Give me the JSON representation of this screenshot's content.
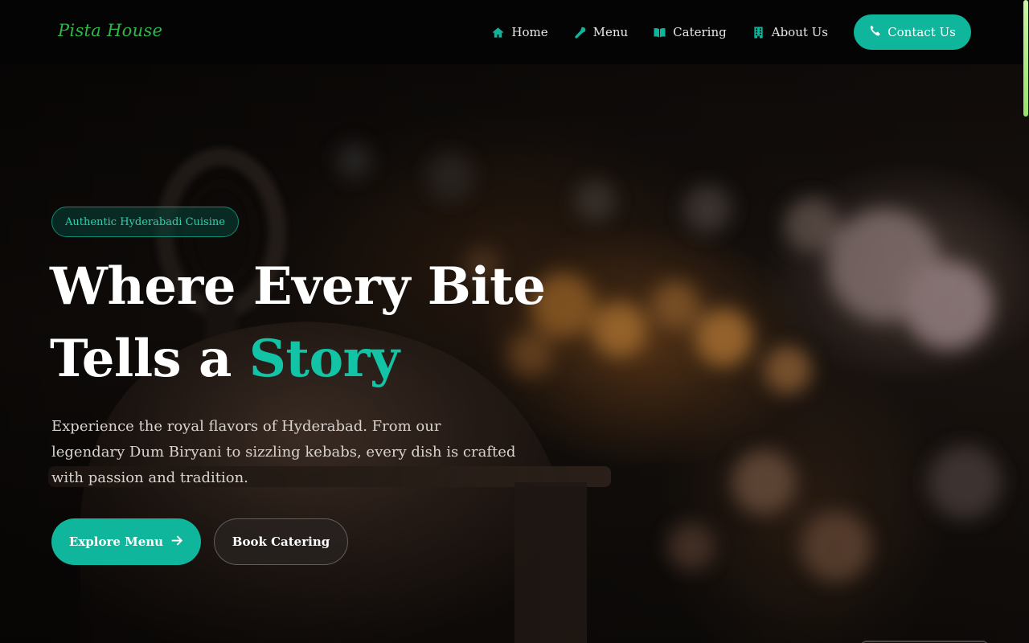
{
  "header": {
    "logo": "Pista House",
    "nav": [
      {
        "label": "Home",
        "icon": "home-icon"
      },
      {
        "label": "Menu",
        "icon": "utensil-icon"
      },
      {
        "label": "Catering",
        "icon": "book-open-icon"
      },
      {
        "label": "About Us",
        "icon": "building-icon"
      }
    ],
    "contact": {
      "label": "Contact Us",
      "icon": "phone-icon"
    }
  },
  "hero": {
    "badge": "Authentic Hyderabadi Cuisine",
    "headline_line1": "Where Every Bite",
    "headline_line2_prefix": "Tells a",
    "headline_accent": "Story",
    "description": "Experience the royal flavors of Hyderabad. From our legendary Dum Biryani to sizzling kebabs, every dish is crafted with passion and tradition.",
    "primary_button": {
      "label": "Explore Menu",
      "icon": "arrow-right-icon"
    },
    "secondary_button": {
      "label": "Book Catering"
    }
  },
  "colors": {
    "accent": "#10b69c",
    "logo": "#2fb84a",
    "header_bg": "#050404"
  }
}
